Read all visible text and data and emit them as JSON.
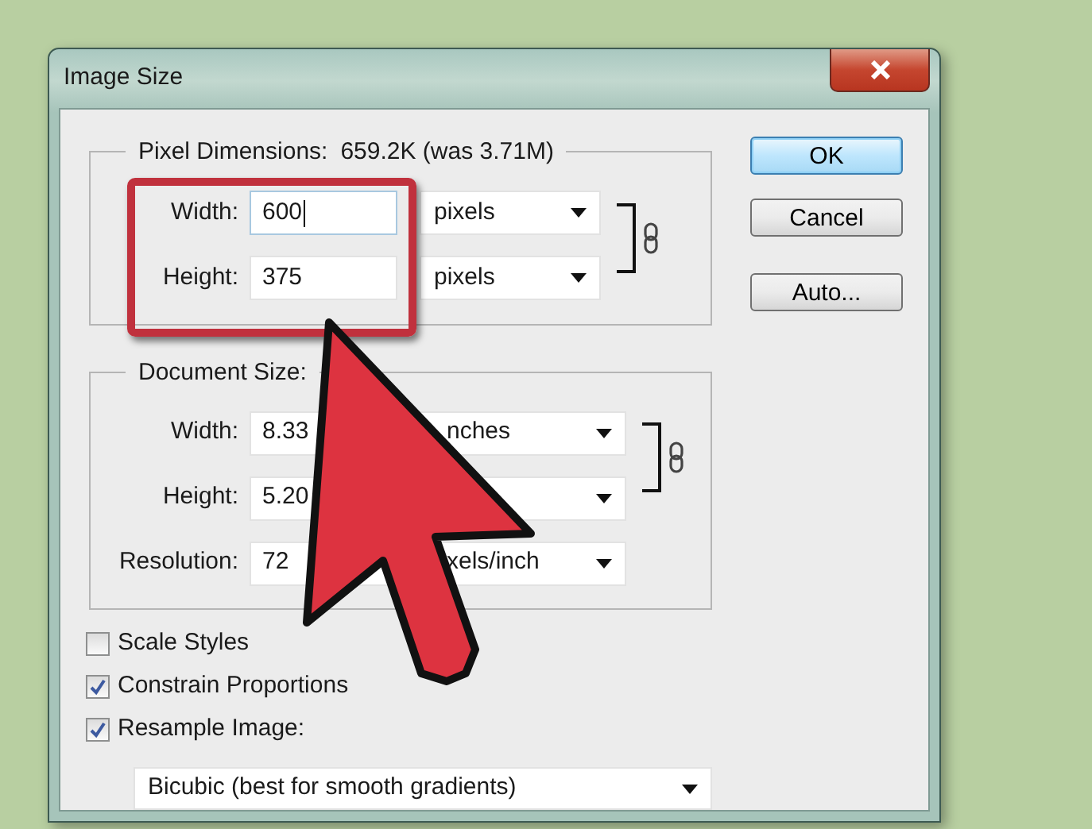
{
  "window": {
    "title": "Image Size"
  },
  "pixel_dimensions": {
    "label": "Pixel Dimensions:",
    "value": "659.2K (was 3.71M)",
    "rows": [
      {
        "label": "Width:",
        "value": "600",
        "unit": "pixels",
        "focused": true
      },
      {
        "label": "Height:",
        "value": "375",
        "unit": "pixels",
        "focused": false
      }
    ]
  },
  "document_size": {
    "label": "Document Size:",
    "rows": [
      {
        "label": "Width:",
        "value": "8.33",
        "unit": "nches"
      },
      {
        "label": "Height:",
        "value": "5.20"
      },
      {
        "label": "Resolution:",
        "value": "72",
        "unit": "xels/inch"
      }
    ]
  },
  "checkboxes": [
    {
      "label": "Scale Styles",
      "checked": false
    },
    {
      "label": "Constrain Proportions",
      "checked": true
    },
    {
      "label": "Resample Image:",
      "checked": true
    }
  ],
  "resample_method": "Bicubic (best for smooth gradients)",
  "buttons": [
    {
      "label": "OK",
      "default": true
    },
    {
      "label": "Cancel",
      "default": false
    },
    {
      "label": "Auto...",
      "default": false
    }
  ]
}
